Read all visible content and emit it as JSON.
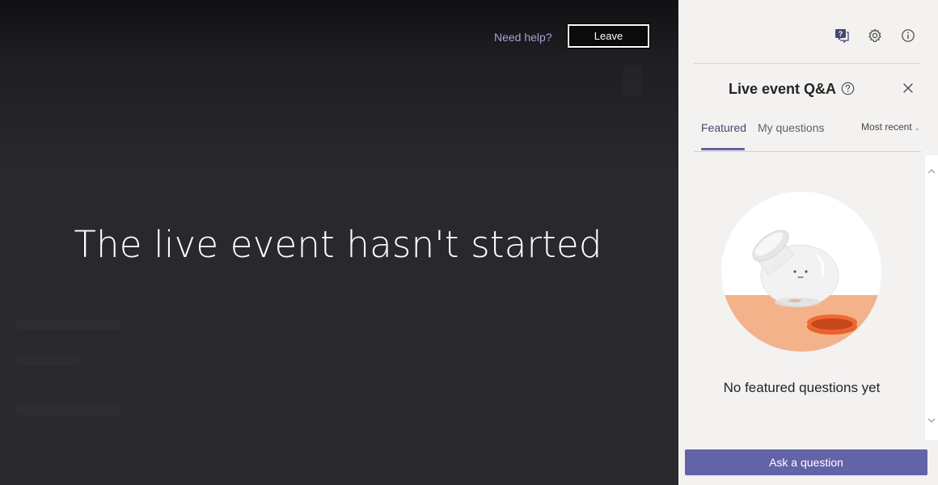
{
  "stage": {
    "message": "The live event hasn't started",
    "help_link": "Need help?",
    "leave_label": "Leave"
  },
  "panel": {
    "header_icons": [
      "qna-icon",
      "gear-icon",
      "info-icon"
    ],
    "title": "Live event Q&A",
    "tabs": [
      {
        "label": "Featured",
        "active": true
      },
      {
        "label": "My questions",
        "active": false
      }
    ],
    "sort_label": "Most recent",
    "empty_message": "No featured questions yet",
    "ask_button": "Ask a question"
  },
  "colors": {
    "accent": "#6264a7",
    "stage_bg": "#2a292e",
    "panel_bg": "#f3f2f1",
    "illustration_peach": "#f4b28a",
    "illustration_orange": "#e9622e"
  }
}
